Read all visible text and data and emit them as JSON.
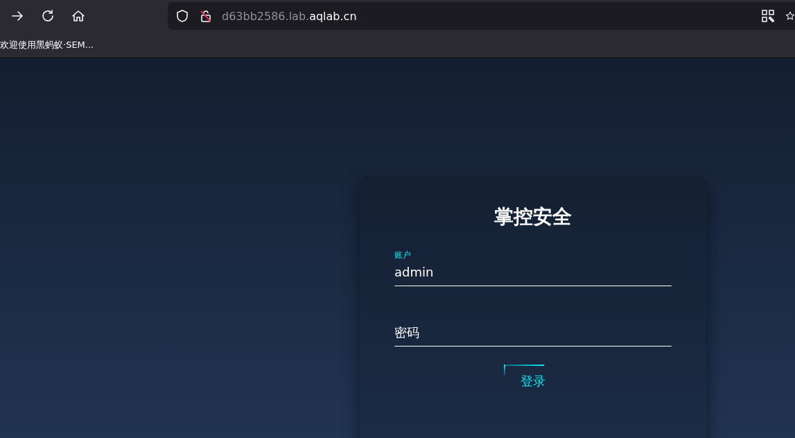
{
  "browser": {
    "url_host": "d63bb2586.lab.",
    "url_domain": "aqlab.cn",
    "bookmarks": [
      "欢迎使用黑蚂蚁·SEM..."
    ]
  },
  "login": {
    "title": "掌控安全",
    "fields": [
      {
        "label": "账户",
        "value": "admin"
      },
      {
        "placeholder": "密码"
      }
    ],
    "button": "登录"
  }
}
